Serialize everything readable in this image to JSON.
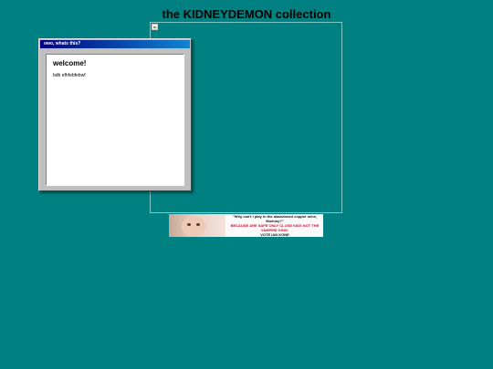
{
  "page": {
    "title": "the KIDNEYDEMON collection"
  },
  "window": {
    "title": "owo, whats this?",
    "heading": "welcome!",
    "body_text": "bdb efhfebfebwf"
  },
  "banner": {
    "quote": "\"Why can't I play in the abandoned copper mine, Mommy?\"",
    "warning": "BECAUSE ARE SAFE ONLY CLOSE KIDS NOT THE VAMPIRE KING.",
    "vote": "VOTE IAN KONE"
  }
}
